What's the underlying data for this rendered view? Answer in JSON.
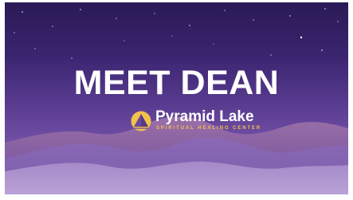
{
  "slide": {
    "title": "MEET DEAN",
    "logo": {
      "name": "Pyramid Lake",
      "tagline": "SPIRITUAL HEALING CENTER",
      "icon": "pyramid-sun-logo-icon"
    }
  },
  "colors": {
    "sky_top": "#2a1a55",
    "sky_bottom": "#8a6ab8",
    "title_text": "#ffffff",
    "logo_accent": "#f2c14e"
  }
}
